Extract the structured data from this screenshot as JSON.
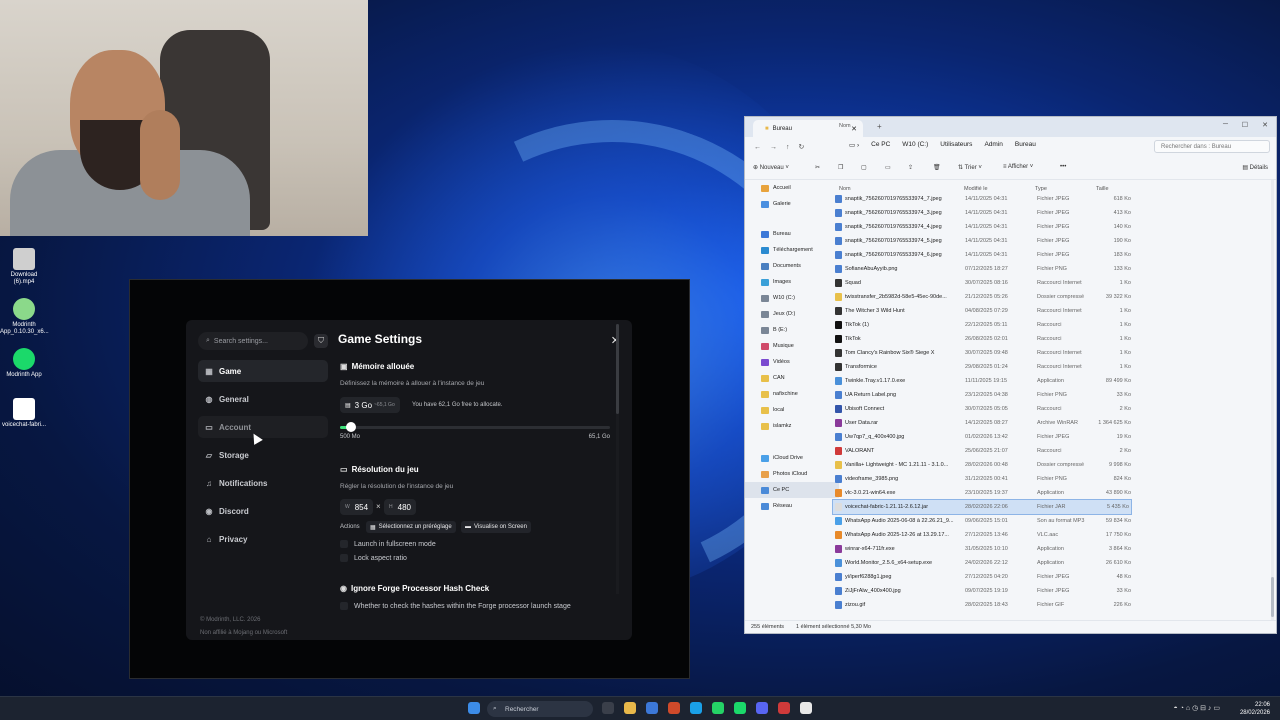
{
  "desktop": {
    "icons": [
      {
        "label": "Download (6).mp4",
        "color": "#d9d9d9"
      },
      {
        "label": "Modrinth App_0.10.30_x6...",
        "color": "#8bd98a"
      },
      {
        "label": "Modrinth App",
        "color": "#1bd96a"
      },
      {
        "label": "voicechat-fabri...",
        "color": "#ffffff"
      }
    ]
  },
  "modrinth": {
    "search_placeholder": "Search settings...",
    "nav": [
      {
        "label": "Game",
        "icon": "gamepad-icon"
      },
      {
        "label": "General",
        "icon": "globe-icon"
      },
      {
        "label": "Account",
        "icon": "card-icon"
      },
      {
        "label": "Storage",
        "icon": "folder-icon"
      },
      {
        "label": "Notifications",
        "icon": "bell-icon"
      },
      {
        "label": "Discord",
        "icon": "discord-icon"
      },
      {
        "label": "Privacy",
        "icon": "lock-icon"
      }
    ],
    "copyright": "© Modrinth, LLC. 2026",
    "disclaimer": "Non affilié à Mojang ou Microsoft",
    "title": "Game Settings",
    "memory": {
      "title": "Mémoire allouée",
      "desc": "Définissez la mémoire à allouer à l'instance de jeu",
      "value": "3 Go",
      "value_sub": "~65,1 Go",
      "free_note": "You have 62,1 Go free to allocate.",
      "min_label": "500 Mo",
      "max_label": "65,1 Go",
      "fraction": 0.04
    },
    "resolution": {
      "title": "Résolution du jeu",
      "desc": "Régler la résolution de l'instance de jeu",
      "w_prefix": "W",
      "width": "854",
      "times": "×",
      "h_prefix": "H",
      "height": "480",
      "actions_label": "Actions",
      "preset_btn": "Sélectionnez un préréglage",
      "visualise_btn": "Visualise on Screen",
      "fullscreen": "Launch in fullscreen mode",
      "aspect": "Lock aspect ratio"
    },
    "forge": {
      "title": "Ignore Forge Processor Hash Check",
      "desc": "Whether to check the hashes within the Forge processor launch stage"
    }
  },
  "explorer": {
    "tab_title": "Bureau",
    "breadcrumbs": [
      "Ce PC",
      "W10 (C:)",
      "Utilisateurs",
      "Admin",
      "Bureau"
    ],
    "search_placeholder": "Rechercher dans : Bureau",
    "toolbar": {
      "new": "Nouveau",
      "sort": "Trier",
      "view": "Afficher",
      "more": "•••",
      "details": "Détails"
    },
    "headers": {
      "name": "Nom",
      "modified": "Modifié le",
      "type": "Type",
      "size": "Taille"
    },
    "sidebar": [
      {
        "label": "Accueil",
        "color": "#e8a33d"
      },
      {
        "label": "Galerie",
        "color": "#4a8fe0"
      },
      {
        "label": "Bureau",
        "color": "#3c78d8"
      },
      {
        "label": "Téléchargement",
        "color": "#2a8ad0"
      },
      {
        "label": "Documents",
        "color": "#4a7fc0"
      },
      {
        "label": "Images",
        "color": "#3aa0d8"
      },
      {
        "label": "W10 (C:)",
        "color": "#7a8696"
      },
      {
        "label": "Jeux (D:)",
        "color": "#7a8696"
      },
      {
        "label": "B (E:)",
        "color": "#7a8696"
      },
      {
        "label": "Musique",
        "color": "#d04a6a"
      },
      {
        "label": "Vidéos",
        "color": "#7a4ad0"
      },
      {
        "label": "CAN",
        "color": "#e8c04a"
      },
      {
        "label": "nafixchine",
        "color": "#e8c04a"
      },
      {
        "label": "local",
        "color": "#e8c04a"
      },
      {
        "label": "islamkz",
        "color": "#e8c04a"
      },
      {
        "label": "iCloud Drive",
        "color": "#4aa0e8"
      },
      {
        "label": "Photos iCloud",
        "color": "#e8a04a"
      },
      {
        "label": "Ce PC",
        "color": "#4a8ad8"
      },
      {
        "label": "Réseau",
        "color": "#4a8ad8"
      }
    ],
    "files": [
      {
        "name": "snaptik_7562607019765533974_7.jpeg",
        "date": "14/11/2025 04:31",
        "type": "Fichier JPEG",
        "size": "618 Ko",
        "color": "#4a7fd0"
      },
      {
        "name": "snaptik_7562607019765533974_3.jpeg",
        "date": "14/11/2025 04:31",
        "type": "Fichier JPEG",
        "size": "413 Ko",
        "color": "#4a7fd0"
      },
      {
        "name": "snaptik_7562607019765533974_4.jpeg",
        "date": "14/11/2025 04:31",
        "type": "Fichier JPEG",
        "size": "140 Ko",
        "color": "#4a7fd0"
      },
      {
        "name": "snaptik_7562607019765533974_5.jpeg",
        "date": "14/11/2025 04:31",
        "type": "Fichier JPEG",
        "size": "190 Ko",
        "color": "#4a7fd0"
      },
      {
        "name": "snaptik_7562607019765533974_6.jpeg",
        "date": "14/11/2025 04:31",
        "type": "Fichier JPEG",
        "size": "183 Ko",
        "color": "#4a7fd0"
      },
      {
        "name": "SofianeAbuAyyib.png",
        "date": "07/12/2025 18:27",
        "type": "Fichier PNG",
        "size": "133 Ko",
        "color": "#4a7fd0"
      },
      {
        "name": "Squad",
        "date": "30/07/2025 08:16",
        "type": "Raccourci Internet",
        "size": "1 Ko",
        "color": "#333333"
      },
      {
        "name": "twisstransfer_2b5982d-58e5-45ec-90de...",
        "date": "21/12/2025 05:26",
        "type": "Dossier compressé",
        "size": "39 322 Ko",
        "color": "#e8c04a"
      },
      {
        "name": "The Witcher 3 Wild Hunt",
        "date": "04/08/2025 07:29",
        "type": "Raccourci Internet",
        "size": "1 Ko",
        "color": "#333333"
      },
      {
        "name": "TikTok (1)",
        "date": "22/12/2025 05:11",
        "type": "Raccourci",
        "size": "1 Ko",
        "color": "#111111"
      },
      {
        "name": "TikTok",
        "date": "26/08/2025 02:01",
        "type": "Raccourci",
        "size": "1 Ko",
        "color": "#111111"
      },
      {
        "name": "Tom Clancy's Rainbow Six® Siege X",
        "date": "30/07/2025 09:48",
        "type": "Raccourci Internet",
        "size": "1 Ko",
        "color": "#333333"
      },
      {
        "name": "Transformice",
        "date": "29/08/2025 01:24",
        "type": "Raccourci Internet",
        "size": "1 Ko",
        "color": "#333333"
      },
      {
        "name": "Twinkle.Tray.v1.17.0.exe",
        "date": "11/11/2025 19:15",
        "type": "Application",
        "size": "89 499 Ko",
        "color": "#4a90d9"
      },
      {
        "name": "UA Return Label.png",
        "date": "23/12/2025 04:38",
        "type": "Fichier PNG",
        "size": "33 Ko",
        "color": "#4a7fd0"
      },
      {
        "name": "Ubisoft Connect",
        "date": "30/07/2025 05:05",
        "type": "Raccourci",
        "size": "2 Ko",
        "color": "#3355aa"
      },
      {
        "name": "User Data.rar",
        "date": "14/12/2025 08:27",
        "type": "Archive WinRAR",
        "size": "1 364 625 Ko",
        "color": "#8a3a9a"
      },
      {
        "name": "Uw7qp7_q_400x400.jpg",
        "date": "01/02/2026 13:42",
        "type": "Fichier JPEG",
        "size": "19 Ko",
        "color": "#4a7fd0"
      },
      {
        "name": "VALORANT",
        "date": "25/06/2025 21:07",
        "type": "Raccourci",
        "size": "2 Ko",
        "color": "#d03a3a"
      },
      {
        "name": "Vanilla+ Lightweight - MC 1.21.11 - 3.1.0...",
        "date": "28/02/2026 00:48",
        "type": "Dossier compressé",
        "size": "9 998 Ko",
        "color": "#e8c04a"
      },
      {
        "name": "videoframe_3985.png",
        "date": "31/12/2025 00:41",
        "type": "Fichier PNG",
        "size": "824 Ko",
        "color": "#4a7fd0"
      },
      {
        "name": "vlc-3.0.21-win64.exe",
        "date": "23/10/2025 19:37",
        "type": "Application",
        "size": "43 890 Ko",
        "color": "#e88a2a"
      },
      {
        "name": "voicechat-fabric-1.21.11-2.6.12.jar",
        "date": "28/02/2026 22:06",
        "type": "Fichier JAR",
        "size": "5 435 Ko",
        "color": "#dddddd"
      },
      {
        "name": "WhatsApp Audio 2025-06-08 à 22.26.21_9...",
        "date": "09/06/2025 15:01",
        "type": "Son au format MP3",
        "size": "59 834 Ko",
        "color": "#4aa0e8"
      },
      {
        "name": "WhatsApp Audio 2025-12-26 at 13.29.17...",
        "date": "27/12/2025 13:46",
        "type": "VLC.aac",
        "size": "17 750 Ko",
        "color": "#e88a2a"
      },
      {
        "name": "winrar-x64-711fr.exe",
        "date": "31/05/2025 10:10",
        "type": "Application",
        "size": "3 864 Ko",
        "color": "#8a3a9a"
      },
      {
        "name": "World.Monitor_2.5.6_x64-setup.exe",
        "date": "24/02/2026 22:12",
        "type": "Application",
        "size": "26 610 Ko",
        "color": "#4a90d9"
      },
      {
        "name": "yi/iperf6288g1.jpeg",
        "date": "27/12/2025 04:20",
        "type": "Fichier JPEG",
        "size": "48 Ko",
        "color": "#4a7fd0"
      },
      {
        "name": "ZiJjFrAlw_400x400.jpg",
        "date": "09/07/2025 19:19",
        "type": "Fichier JPEG",
        "size": "33 Ko",
        "color": "#4a7fd0"
      },
      {
        "name": "zizou.gif",
        "date": "28/02/2025 18:43",
        "type": "Fichier GIF",
        "size": "226 Ko",
        "color": "#4a7fd0"
      }
    ],
    "selected_index": 22,
    "status_count": "255 éléments",
    "status_selected": "1 élément sélectionné  5,30 Mo"
  },
  "taskbar": {
    "search": "Rechercher",
    "time": "22:06",
    "date": "28/02/2026",
    "app_colors": [
      "#3a3f4a",
      "#e8b84a",
      "#3c78d8",
      "#d04a2a",
      "#1aa0e8",
      "#25d366",
      "#1bd96a",
      "#5865f2",
      "#d03a3a",
      "#e8e8e8"
    ]
  }
}
